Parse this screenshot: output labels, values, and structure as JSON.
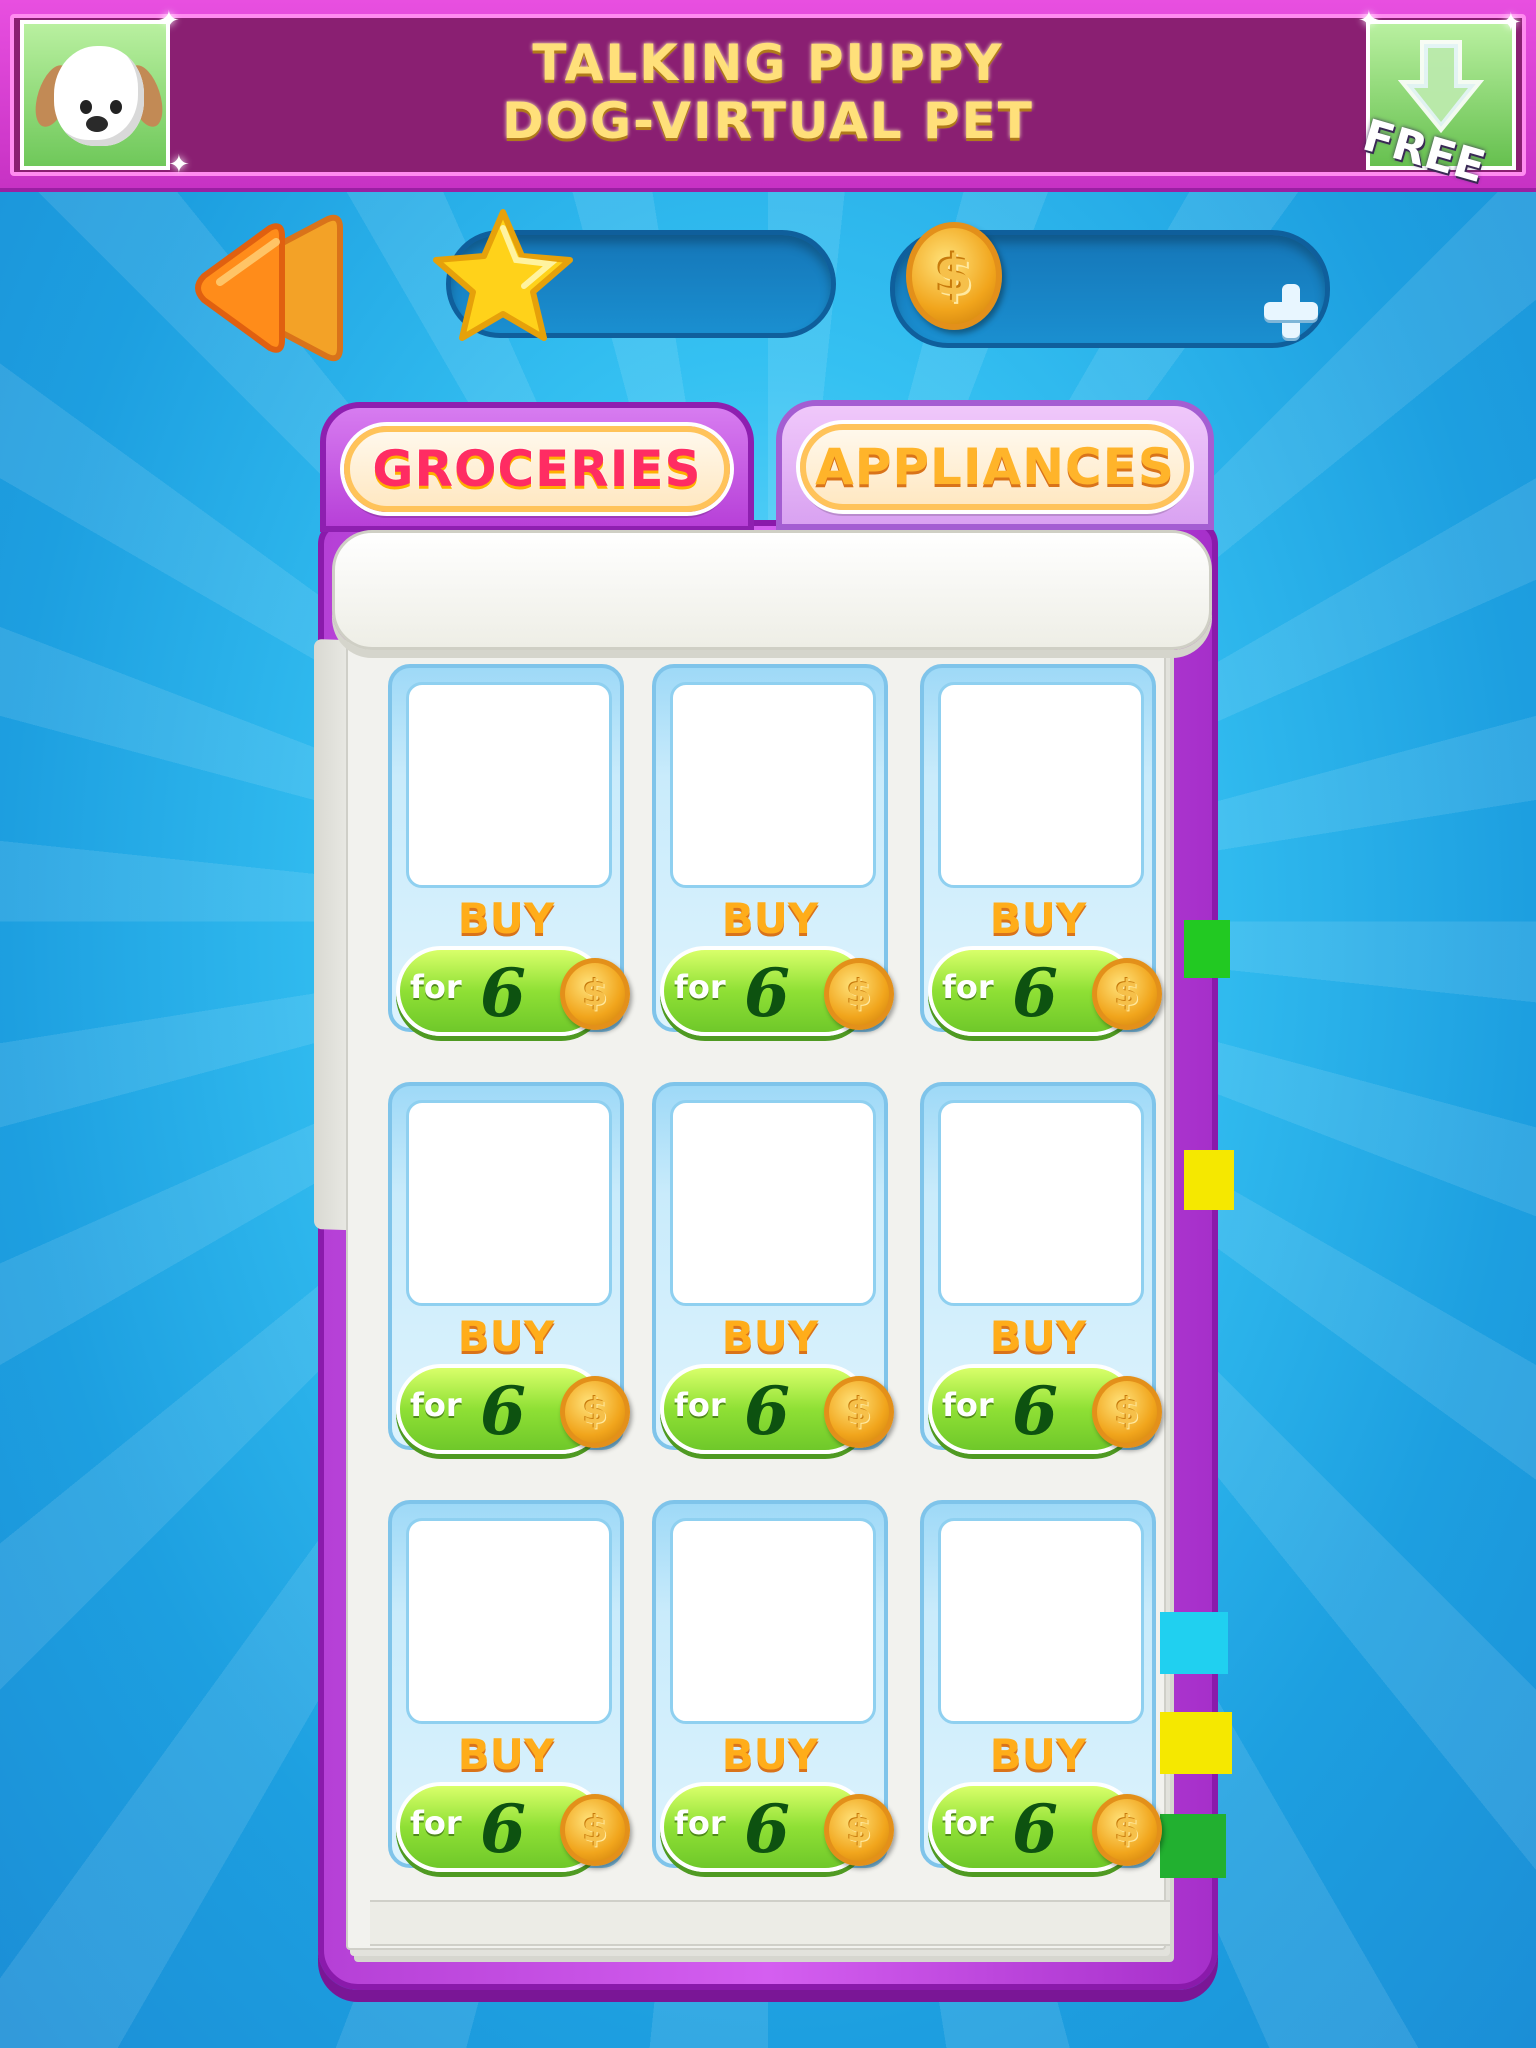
{
  "banner": {
    "title_line1": "TALKING PUPPY",
    "title_line2": "DOG-VIRTUAL PET",
    "badge": "FREE",
    "colors": {
      "frame": "#c732c4",
      "panel": "#8a1f72",
      "title": "#ffe07a"
    },
    "icons": {
      "app": "puppy-app-icon",
      "download": "download-arrow-icon"
    }
  },
  "hud": {
    "back_icon": "double-chevron-left-icon",
    "stars_icon": "star-icon",
    "coins_icon": "coin-icon",
    "coin_symbol": "$",
    "add_icon": "plus-icon",
    "stars_value": "",
    "coins_value": ""
  },
  "tabs": [
    {
      "label": "GROCERIES",
      "active": true
    },
    {
      "label": "APPLIANCES",
      "active": false
    }
  ],
  "side_tab_colors": [
    "#22c922",
    "#f5e800",
    "#20d0f0",
    "#f5e800",
    "#22b030"
  ],
  "items": [
    {
      "buy": "BUY",
      "for": "for",
      "price": "6",
      "coin": "$"
    },
    {
      "buy": "BUY",
      "for": "for",
      "price": "6",
      "coin": "$"
    },
    {
      "buy": "BUY",
      "for": "for",
      "price": "6",
      "coin": "$"
    },
    {
      "buy": "BUY",
      "for": "for",
      "price": "6",
      "coin": "$"
    },
    {
      "buy": "BUY",
      "for": "for",
      "price": "6",
      "coin": "$"
    },
    {
      "buy": "BUY",
      "for": "for",
      "price": "6",
      "coin": "$"
    },
    {
      "buy": "BUY",
      "for": "for",
      "price": "6",
      "coin": "$"
    },
    {
      "buy": "BUY",
      "for": "for",
      "price": "6",
      "coin": "$"
    },
    {
      "buy": "BUY",
      "for": "for",
      "price": "6",
      "coin": "$"
    }
  ]
}
